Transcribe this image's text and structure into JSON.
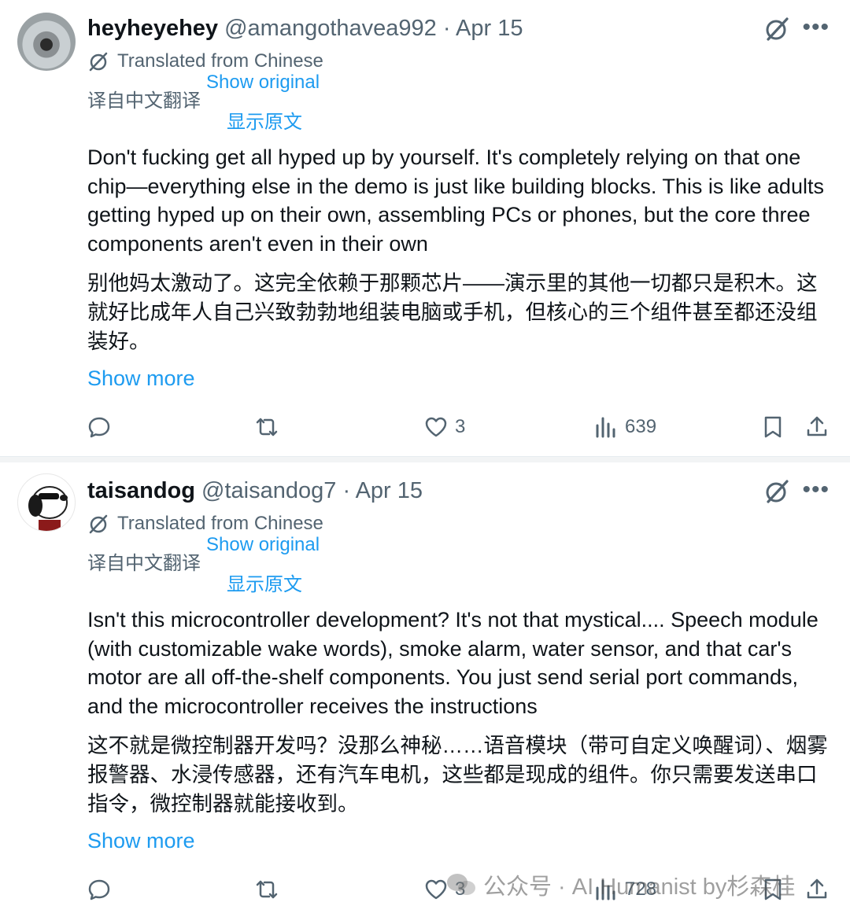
{
  "tweets": [
    {
      "name": "heyheyehey",
      "handle": "@amangothavea992",
      "dot": "·",
      "date": "Apr 15",
      "more": "•••",
      "translated_label": "Translated from Chinese",
      "translated_label_cn": "译自中文翻译",
      "show_original": "Show original",
      "show_original_cn": "显示原文",
      "body_en": "Don't fucking get all hyped up by yourself. It's completely relying on that one chip—everything else in the demo is just like building blocks. This is like adults getting hyped up on their own, assembling PCs or phones, but the core three components aren't even in their own",
      "body_cn": "别他妈太激动了。这完全依赖于那颗芯片——演示里的其他一切都只是积木。这就好比成年人自己兴致勃勃地组装电脑或手机，但核心的三个组件甚至都还没组装好。",
      "show_more": "Show more",
      "likes": "3",
      "views": "639"
    },
    {
      "name": "taisandog",
      "handle": "@taisandog7",
      "dot": "·",
      "date": "Apr 15",
      "more": "•••",
      "translated_label": "Translated from Chinese",
      "translated_label_cn": "译自中文翻译",
      "show_original": "Show original",
      "show_original_cn": "显示原文",
      "body_en": "Isn't this microcontroller development? It's not that mystical.... Speech module (with customizable wake words), smoke alarm, water sensor, and that car's motor are all off-the-shelf components. You just send serial port commands, and the microcontroller receives the instructions",
      "body_cn": "这不就是微控制器开发吗？没那么神秘……语音模块（带可自定义唤醒词）、烟雾报警器、水浸传感器，还有汽车电机，这些都是现成的组件。你只需要发送串口指令，微控制器就能接收到。",
      "show_more": "Show more",
      "likes": "3",
      "views": "728"
    }
  ],
  "watermark": {
    "text": "公众号 · AI Humanist by杉森桂"
  },
  "colors": {
    "link": "#1d9bf0",
    "secondary_text": "#536471",
    "primary_text": "#0f1419"
  },
  "icons": {
    "reply": "reply-icon",
    "retweet": "retweet-icon",
    "like": "heart-icon",
    "views": "views-icon",
    "bookmark": "bookmark-icon",
    "share": "share-icon",
    "grok": "grok-icon",
    "translate": "translate-icon",
    "more": "more-icon"
  }
}
